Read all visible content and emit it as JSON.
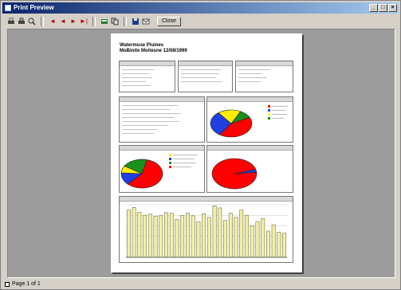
{
  "window": {
    "title": "Print Preview",
    "buttons": [
      "_",
      "□",
      "×"
    ]
  },
  "toolbar": {
    "icons": [
      "printer-icon",
      "print-setup-icon",
      "zoom-icon",
      "first-page-icon",
      "previous-page-icon",
      "next-page-icon",
      "last-page-icon",
      "export-icon",
      "copy-icon",
      "save-icon",
      "mail-icon"
    ],
    "nav_glyphs": {
      "first": "◄",
      "prev": "◄",
      "next": "►",
      "last": "►|"
    },
    "close_label": "Close"
  },
  "report": {
    "title_line1": "Watermuse Plumes",
    "title_line2": "MoBinite Moitesne 12/08/1999"
  },
  "status": {
    "page_label": "Page 1 of 1"
  },
  "colors": {
    "titlebar_start": "#0a246a",
    "titlebar_end": "#a6caf0",
    "pie_red": "#ff0000",
    "pie_blue": "#1f3fe0",
    "pie_yellow": "#ffee00",
    "pie_green": "#1a8f1a",
    "bar_fill": "#f2f0a8",
    "bar_edge": "#5b5b2c"
  },
  "chart_data": [
    {
      "type": "pie",
      "values": [
        42,
        30,
        18,
        10
      ]
    },
    {
      "type": "pie",
      "values": [
        58,
        14,
        8,
        20
      ]
    },
    {
      "type": "pie",
      "values": [
        97,
        3
      ]
    },
    {
      "type": "bar",
      "values": [
        90,
        95,
        86,
        80,
        82,
        78,
        79,
        85,
        84,
        72,
        80,
        84,
        79,
        68,
        83,
        76,
        98,
        94,
        70,
        84,
        76,
        90,
        80,
        60,
        68,
        74,
        50,
        62,
        48,
        46
      ]
    }
  ]
}
